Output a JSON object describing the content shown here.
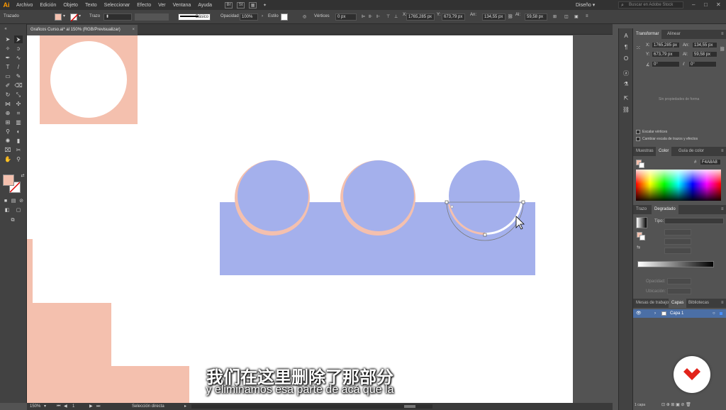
{
  "menubar": {
    "app_logo": "Ai",
    "items": [
      "Archivo",
      "Edición",
      "Objeto",
      "Texto",
      "Seleccionar",
      "Efecto",
      "Ver",
      "Ventana",
      "Ayuda"
    ],
    "br_badge": "Br",
    "st_badge": "St",
    "workspace": "Diseño",
    "stock_search_placeholder": "Buscar en Adobe Stock"
  },
  "controlbar": {
    "selection_label": "Trazado",
    "fill_color": "#f4c0ae",
    "stroke_label": "Trazo",
    "brush_label": "Básico",
    "opacity_label": "Opacidad",
    "opacity_value": "100%",
    "style_label": "Estilo",
    "vertices_label": "Vértices",
    "vertices_value": "0 px",
    "x_value": "1765,285 px",
    "y_value": "673,79 px",
    "w_value": "134,55 px",
    "h_value": "59,58 px"
  },
  "document": {
    "tab_title": "Graficos Curso.ai* al 150% (RGB/Previsualizar)",
    "close_glyph": "×"
  },
  "canvas": {
    "peach_color": "#f4c0ae",
    "blue_color": "#a4b0ec",
    "selection_color": "#7a7a7a"
  },
  "subtitles": {
    "chinese": "我们在这里删除了那部分",
    "spanish": "y eliminamos esa parte de acá que la"
  },
  "statusbar": {
    "zoom": "150%",
    "artboard": "1",
    "tool_name": "Selección directa"
  },
  "transform_panel": {
    "tabs": [
      "Transformar",
      "Alinear"
    ],
    "x_label": "X:",
    "x_value": "1765,285 px",
    "y_label": "Y:",
    "y_value": "673,79 px",
    "w_label": "An:",
    "w_value": "134,55 px",
    "h_label": "Al:",
    "h_value": "59,58 px",
    "angle_value": "0°",
    "shear_value": "0°",
    "no_shape_props": "Sin propiedades de forma",
    "scale_corners": "Escalar vértices",
    "scale_strokes": "Cambiar escala de trazos y efectos"
  },
  "color_panel": {
    "tabs": [
      "Muestras",
      "Color",
      "Guía de color"
    ],
    "hex_value": "F4A8A8"
  },
  "gradient_panel": {
    "tabs": [
      "Trazo",
      "Degradado"
    ],
    "type_label": "Tipo:",
    "opacity_label": "Opacidad:",
    "location_label": "Ubicación:"
  },
  "layers_panel": {
    "tabs": [
      "Mesas de trabajo",
      "Capas",
      "Bibliotecas"
    ],
    "layer_name": "Capa 1",
    "footer": "1 capa"
  }
}
